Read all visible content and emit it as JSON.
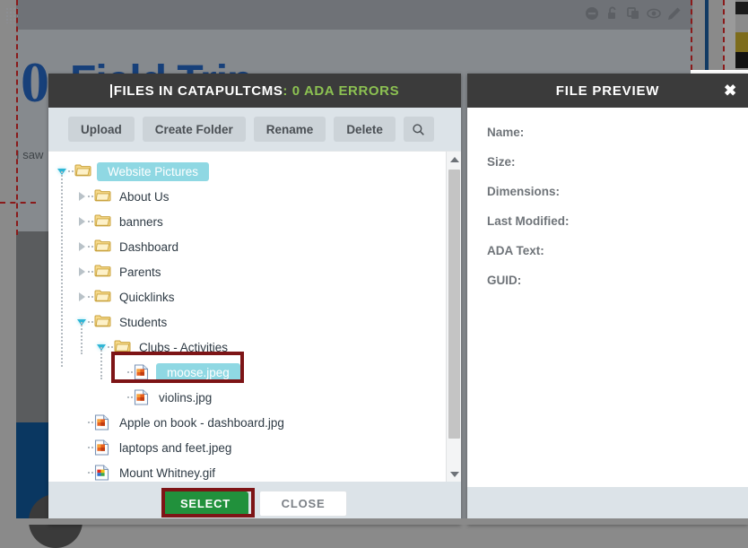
{
  "background": {
    "big_number": "0",
    "heading": "Field Trip",
    "subtext": "I saw",
    "toolbar_icons": [
      {
        "name": "minus-circle-icon"
      },
      {
        "name": "unlock-icon"
      },
      {
        "name": "copy-icon"
      },
      {
        "name": "eye-icon"
      },
      {
        "name": "pencil-icon"
      }
    ],
    "grip_icon": "drag-grip-icon"
  },
  "file_dialog": {
    "title_main": "FILES IN CATAPULTCMS",
    "title_ada": ": 0 ADA ERRORS",
    "ada_color": "#8cc152",
    "toolbar": [
      {
        "label": "Upload",
        "name": "upload-button"
      },
      {
        "label": "Create Folder",
        "name": "create-folder-button"
      },
      {
        "label": "Rename",
        "name": "rename-button"
      },
      {
        "label": "Delete",
        "name": "delete-button"
      }
    ],
    "search_icon": "search-icon",
    "tree": [
      {
        "label": "Website Pictures",
        "type": "folder",
        "depth": 0,
        "state": "expanded",
        "selected": true
      },
      {
        "label": "About Us",
        "type": "folder",
        "depth": 1,
        "state": "collapsed",
        "selected": false
      },
      {
        "label": "banners",
        "type": "folder",
        "depth": 1,
        "state": "collapsed",
        "selected": false
      },
      {
        "label": "Dashboard",
        "type": "folder",
        "depth": 1,
        "state": "collapsed",
        "selected": false
      },
      {
        "label": "Parents",
        "type": "folder",
        "depth": 1,
        "state": "collapsed",
        "selected": false
      },
      {
        "label": "Quicklinks",
        "type": "folder",
        "depth": 1,
        "state": "collapsed",
        "selected": false
      },
      {
        "label": "Students",
        "type": "folder",
        "depth": 1,
        "state": "expanded",
        "selected": false
      },
      {
        "label": "Clubs - Activities",
        "type": "folder",
        "depth": 2,
        "state": "expanded",
        "selected": false
      },
      {
        "label": "moose.jpeg",
        "type": "image",
        "depth": 3,
        "state": "leaf",
        "selected": true
      },
      {
        "label": "violins.jpg",
        "type": "image",
        "depth": 3,
        "state": "leaf",
        "selected": false
      },
      {
        "label": "Apple on book - dashboard.jpg",
        "type": "image",
        "depth": 1,
        "state": "leaf",
        "selected": false
      },
      {
        "label": "laptops and feet.jpeg",
        "type": "image",
        "depth": 1,
        "state": "leaf",
        "selected": false
      },
      {
        "label": "Mount Whitney.gif",
        "type": "gif",
        "depth": 1,
        "state": "leaf",
        "selected": false
      }
    ],
    "selection_color": "#8fd8e3",
    "footer": {
      "select_label": "SELECT",
      "close_label": "CLOSE",
      "select_color": "#21913c"
    },
    "scrollbar": {
      "up_icon": "scroll-up-arrow-icon",
      "down_icon": "scroll-down-arrow-icon"
    }
  },
  "preview_panel": {
    "title": "FILE PREVIEW",
    "close_icon": "close-icon",
    "fields": [
      {
        "label": "Name:"
      },
      {
        "label": "Size:"
      },
      {
        "label": "Dimensions:"
      },
      {
        "label": "Last Modified:"
      },
      {
        "label": "ADA Text:"
      },
      {
        "label": "GUID:"
      }
    ]
  },
  "annotations": {
    "color": "#7d1416",
    "boxes": [
      "moose-file-highlight",
      "select-button-highlight"
    ]
  }
}
